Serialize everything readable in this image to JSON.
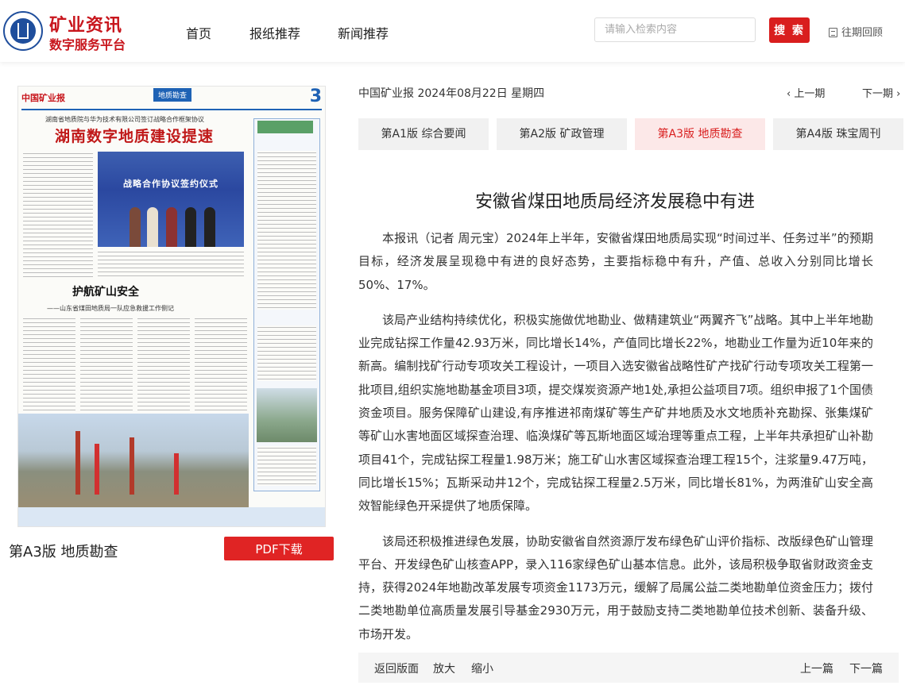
{
  "header": {
    "brand_line1": "矿业资讯",
    "brand_line2": "数字服务平台",
    "nav": [
      "首页",
      "报纸推荐",
      "新闻推荐"
    ],
    "search_placeholder": "请输入检索内容",
    "search_button": "搜 索",
    "past_issues": "往期回顾"
  },
  "newspaper_page": {
    "masthead": "中国矿业报",
    "section_tag": "地质勘查",
    "page_number": "3",
    "subhead": "湖南省地质院与华为技术有限公司签订战略合作框架协议",
    "headline": "湖南数字地质建设提速",
    "photo_caption": "战略合作协议签约仪式",
    "headline2": "护航矿山安全",
    "subhead2": "——山东省煤田地质局一队应急救援工作侧记",
    "label": "第A3版 地质勘查",
    "pdf_button": "PDF下载"
  },
  "issue": {
    "info": "中国矿业报 2024年08月22日 星期四",
    "prev": "上一期",
    "next": "下一期"
  },
  "tabs": [
    {
      "label": "第A1版 综合要闻",
      "active": false
    },
    {
      "label": "第A2版 矿政管理",
      "active": false
    },
    {
      "label": "第A3版 地质勘查",
      "active": true
    },
    {
      "label": "第A4版 珠宝周刊",
      "active": false
    }
  ],
  "article": {
    "title": "安徽省煤田地质局经济发展稳中有进",
    "paragraphs": [
      "本报讯（记者 周元宝）2024年上半年，安徽省煤田地质局实现“时间过半、任务过半”的预期目标，经济发展呈现稳中有进的良好态势，主要指标稳中有升，产值、总收入分别同比增长50%、17%。",
      "该局产业结构持续优化，积极实施做优地勘业、做精建筑业“两翼齐飞”战略。其中上半年地勘业完成钻探工作量42.93万米，同比增长14%，产值同比增长22%，地勘业工作量为近10年来的新高。编制找矿行动专项攻关工程设计，一项目入选安徽省战略性矿产找矿行动专项攻关工程第一批项目,组织实施地勘基金项目3项，提交煤炭资源产地1处,承担公益项目7项。组织申报了1个国债资金项目。服务保障矿山建设,有序推进祁南煤矿等生产矿井地质及水文地质补充勘探、张集煤矿等矿山水害地面区域探查治理、临涣煤矿等瓦斯地面区域治理等重点工程，上半年共承担矿山补勘项目41个，完成钻探工程量1.98万米；施工矿山水害区域探查治理工程15个，注浆量9.47万吨，同比增长15%；瓦斯采动井12个，完成钻探工程量2.5万米，同比增长81%，为两淮矿山安全高效智能绿色开采提供了地质保障。",
      "该局还积极推进绿色发展，协助安徽省自然资源厅发布绿色矿山评价指标、改版绿色矿山管理平台、开发绿色矿山核查APP，录入116家绿色矿山基本信息。此外，该局积极争取省财政资金支持，获得2024年地勘改革发展专项资金1173万元，缓解了局属公益二类地勘单位资金压力；拨付二类地勘单位高质量发展引导基金2930万元，用于鼓励支持二类地勘单位技术创新、装备升级、市场开发。"
    ]
  },
  "bottom": {
    "back": "返回版面",
    "zoom_in": "放大",
    "zoom_out": "缩小",
    "prev_article": "上一篇",
    "next_article": "下一篇"
  },
  "colors": {
    "accent": "#d91e1e",
    "brand_blue": "#1f4e9c",
    "active_tab_bg": "#fce8e8"
  }
}
